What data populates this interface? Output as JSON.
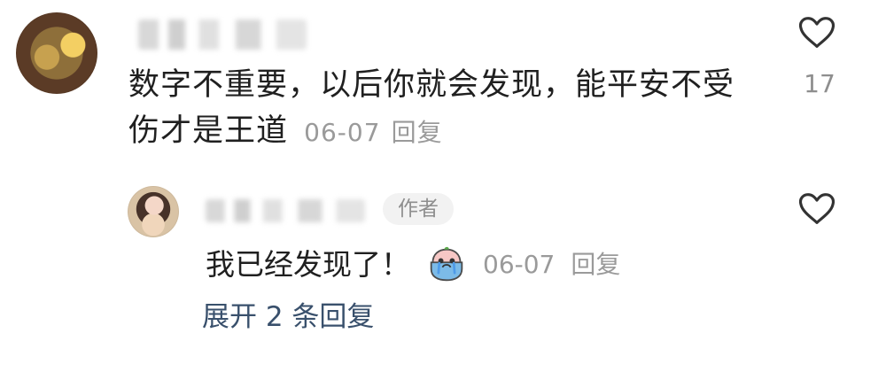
{
  "comment": {
    "text": "数字不重要，以后你就会发现，能平安不受伤才是王道",
    "date": "06-07",
    "reply_action": "回复",
    "likes": "17"
  },
  "reply": {
    "author_badge": "作者",
    "text": "我已经发现了！",
    "date": "06-07",
    "reply_action": "回复"
  },
  "thread": {
    "expand_label": "展开 2 条回复"
  },
  "icons": {
    "like_main": "heart-outline",
    "like_reply": "heart-outline",
    "emoji": "crying-bowl-face"
  }
}
